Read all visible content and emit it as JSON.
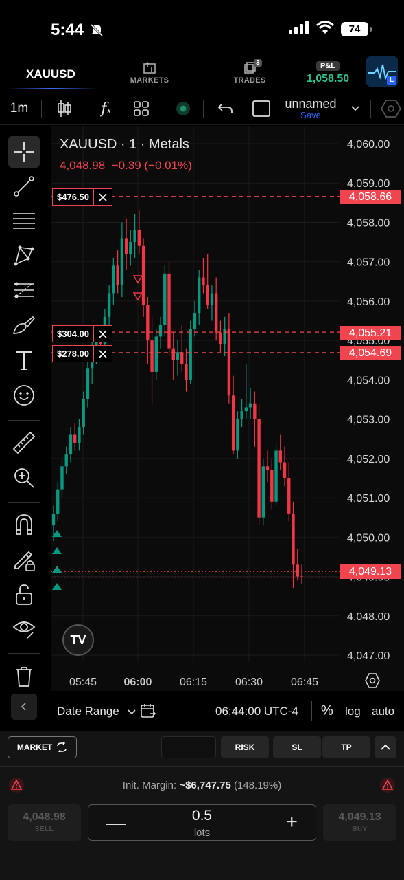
{
  "status_bar": {
    "time": "5:44",
    "battery": "74"
  },
  "nav": {
    "symbol": "XAUUSD",
    "markets_label": "MARKETS",
    "trades_label": "TRADES",
    "trades_count": "3",
    "pnl_label": "P&L",
    "pnl_value": "1,058.50",
    "avatar_badge": "L"
  },
  "toolbar": {
    "interval": "1m",
    "layout_name": "unnamed",
    "save_label": "Save"
  },
  "chart": {
    "title": "XAUUSD · 1 · Metals",
    "last_price": "4,048.98",
    "change": "−0.39 (−0.01%)",
    "logo_text": "TV",
    "order_tags": [
      {
        "amount": "$476.50"
      },
      {
        "amount": "$304.00"
      },
      {
        "amount": "$278.00"
      }
    ],
    "price_tags": [
      "4,058.66",
      "4,055.21",
      "4,054.69",
      "4,049.13"
    ],
    "colors": {
      "up": "#089981",
      "down": "#f23645",
      "tag": "#f0444f"
    }
  },
  "chart_data": {
    "type": "candlestick",
    "title": "XAUUSD · 1 · Metals",
    "y_ticks": [
      "4,060.00",
      "4,059.00",
      "4,058.00",
      "4,057.00",
      "4,056.00",
      "4,055.00",
      "4,054.00",
      "4,053.00",
      "4,052.00",
      "4,051.00",
      "4,050.00",
      "4,049.00",
      "4,048.00",
      "4,047.00"
    ],
    "x_ticks": [
      "05:45",
      "06:00",
      "06:15",
      "06:30",
      "06:45"
    ],
    "ylim": [
      4046.2,
      4060.4
    ],
    "horizontal_lines": [
      4058.66,
      4055.21,
      4054.69,
      4049.13,
      4048.98
    ],
    "candles": [
      [
        4050.3,
        4050.8,
        4049.9,
        4050.6
      ],
      [
        4050.6,
        4051.4,
        4050.4,
        4051.2
      ],
      [
        4051.2,
        4052.0,
        4051.0,
        4051.8
      ],
      [
        4051.8,
        4052.3,
        4051.6,
        4052.1
      ],
      [
        4052.1,
        4052.8,
        4051.9,
        4052.6
      ],
      [
        4052.6,
        4052.9,
        4052.2,
        4052.4
      ],
      [
        4052.4,
        4053.0,
        4052.2,
        4052.8
      ],
      [
        4052.8,
        4053.7,
        4052.6,
        4053.5
      ],
      [
        4053.5,
        4054.5,
        4053.3,
        4054.3
      ],
      [
        4054.3,
        4055.0,
        4053.9,
        4054.8
      ],
      [
        4054.8,
        4055.2,
        4054.4,
        4055.0
      ],
      [
        4055.0,
        4055.4,
        4054.6,
        4054.9
      ],
      [
        4054.9,
        4055.8,
        4054.7,
        4055.6
      ],
      [
        4055.6,
        4056.4,
        4055.4,
        4056.2
      ],
      [
        4056.2,
        4057.1,
        4055.9,
        4056.9
      ],
      [
        4056.9,
        4057.3,
        4056.2,
        4056.4
      ],
      [
        4056.4,
        4058.0,
        4056.1,
        4057.6
      ],
      [
        4057.6,
        4058.1,
        4056.8,
        4057.2
      ],
      [
        4057.2,
        4057.8,
        4056.9,
        4057.5
      ],
      [
        4057.5,
        4058.2,
        4057.1,
        4057.8
      ],
      [
        4057.8,
        4058.3,
        4057.2,
        4057.4
      ],
      [
        4057.4,
        4057.6,
        4055.6,
        4055.9
      ],
      [
        4055.9,
        4056.1,
        4054.4,
        4055.0
      ],
      [
        4055.0,
        4055.6,
        4053.4,
        4054.2
      ],
      [
        4054.2,
        4055.3,
        4054.0,
        4055.1
      ],
      [
        4055.1,
        4055.6,
        4054.8,
        4055.4
      ],
      [
        4055.4,
        4056.9,
        4055.1,
        4056.7
      ],
      [
        4056.7,
        4057.0,
        4054.6,
        4054.8
      ],
      [
        4054.8,
        4055.2,
        4054.0,
        4054.5
      ],
      [
        4054.5,
        4055.0,
        4054.1,
        4054.7
      ],
      [
        4054.7,
        4055.4,
        4054.2,
        4054.4
      ],
      [
        4054.4,
        4054.8,
        4053.7,
        4054.0
      ],
      [
        4054.0,
        4055.5,
        4053.9,
        4055.3
      ],
      [
        4055.3,
        4056.0,
        4055.1,
        4055.7
      ],
      [
        4055.7,
        4056.8,
        4055.4,
        4056.6
      ],
      [
        4056.6,
        4057.1,
        4056.2,
        4056.4
      ],
      [
        4056.4,
        4057.2,
        4055.8,
        4055.9
      ],
      [
        4055.9,
        4056.4,
        4055.5,
        4056.2
      ],
      [
        4056.2,
        4056.6,
        4055.0,
        4055.2
      ],
      [
        4055.2,
        4055.5,
        4054.7,
        4054.9
      ],
      [
        4054.9,
        4055.6,
        4054.6,
        4055.3
      ],
      [
        4055.3,
        4055.7,
        4053.4,
        4053.6
      ],
      [
        4053.6,
        4054.1,
        4052.1,
        4052.2
      ],
      [
        4052.2,
        4053.2,
        4052.0,
        4053.0
      ],
      [
        4053.0,
        4053.5,
        4052.8,
        4053.2
      ],
      [
        4053.2,
        4054.4,
        4053.0,
        4053.3
      ],
      [
        4053.3,
        4053.8,
        4053.0,
        4053.4
      ],
      [
        4053.4,
        4053.7,
        4052.3,
        4053.0
      ],
      [
        4053.0,
        4053.4,
        4050.3,
        4050.5
      ],
      [
        4050.5,
        4052.0,
        4050.3,
        4051.8
      ],
      [
        4051.8,
        4052.2,
        4051.4,
        4051.7
      ],
      [
        4051.7,
        4052.0,
        4050.7,
        4050.9
      ],
      [
        4050.9,
        4052.4,
        4050.8,
        4052.2
      ],
      [
        4052.2,
        4052.6,
        4051.7,
        4051.9
      ],
      [
        4051.9,
        4052.3,
        4051.3,
        4051.5
      ],
      [
        4051.5,
        4051.9,
        4050.4,
        4050.6
      ],
      [
        4050.6,
        4050.9,
        4048.7,
        4049.3
      ],
      [
        4049.3,
        4049.7,
        4048.9,
        4049.0
      ],
      [
        4049.0,
        4049.3,
        4048.8,
        4048.98
      ]
    ]
  },
  "bottom_controls": {
    "date_range_label": "Date Range",
    "time_label": "06:44:00 UTC-4",
    "percent_label": "%",
    "log_label": "log",
    "auto_label": "auto"
  },
  "trade_panel": {
    "market_label": "MARKET",
    "risk_label": "RISK",
    "sl_label": "SL",
    "tp_label": "TP",
    "margin_label": "Init. Margin:",
    "margin_value": "~$6,747.75",
    "margin_pct": "(148.19%)",
    "sell_price": "4,048.98",
    "sell_label": "SELL",
    "lots_value": "0.5",
    "lots_label": "lots",
    "buy_price": "4,049.13",
    "buy_label": "BUY"
  }
}
